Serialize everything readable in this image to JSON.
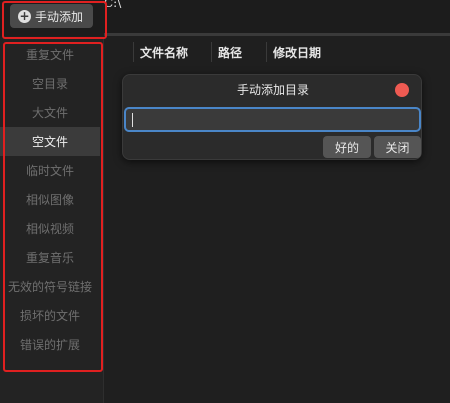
{
  "toolbar": {
    "add_manual_label": "手动添加",
    "path_text": "C:\\"
  },
  "sidebar": {
    "items": [
      {
        "label": "重复文件",
        "active": false
      },
      {
        "label": "空目录",
        "active": false
      },
      {
        "label": "大文件",
        "active": false
      },
      {
        "label": "空文件",
        "active": true
      },
      {
        "label": "临时文件",
        "active": false
      },
      {
        "label": "相似图像",
        "active": false
      },
      {
        "label": "相似视频",
        "active": false
      },
      {
        "label": "重复音乐",
        "active": false
      },
      {
        "label": "无效的符号链接",
        "active": false
      },
      {
        "label": "损坏的文件",
        "active": false
      },
      {
        "label": "错误的扩展",
        "active": false
      }
    ]
  },
  "table": {
    "columns": [
      "文件名称",
      "路径",
      "修改日期"
    ]
  },
  "dialog": {
    "title": "手动添加目录",
    "input_value": "",
    "ok_label": "好的",
    "close_label": "关闭"
  },
  "colors": {
    "background": "#1f1f1f",
    "sidebar_active": "#3b3b3b",
    "close_dot": "#ee5a52",
    "input_focus": "#4a86c8",
    "annotation": "#e02020"
  }
}
